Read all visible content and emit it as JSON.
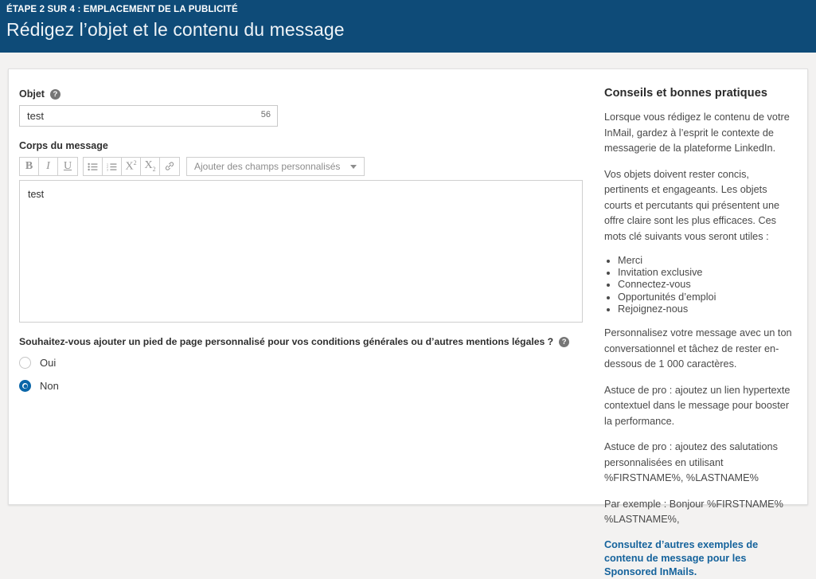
{
  "header": {
    "eyebrow": "ÉTAPE 2 SUR 4 : EMPLACEMENT DE LA PUBLICITÉ",
    "title": "Rédigez l’objet et le contenu du message",
    "bg_color": "#0e4b78"
  },
  "form": {
    "subject": {
      "label": "Objet",
      "help_icon": "help-circle-icon",
      "value": "test",
      "placeholder": "",
      "char_count": "56"
    },
    "body": {
      "label": "Corps du message",
      "value": "test",
      "placeholder": ""
    },
    "toolbar": {
      "bold": "B",
      "italic": "I",
      "underline": "U",
      "bulleted_list_icon": "bulleted-list-icon",
      "numbered_list_icon": "numbered-list-icon",
      "superscript": "X",
      "superscript_exp": "2",
      "subscript": "X",
      "subscript_exp": "2",
      "link_icon": "link-icon",
      "custom_fields_label": "Ajouter des champs personnalisés",
      "caret_icon": "chevron-down-icon"
    },
    "footer_question": {
      "text": "Souhaitez-vous ajouter un pied de page personnalisé pour vos conditions générales ou d’autres mentions légales ?",
      "help_icon": "help-circle-icon",
      "options": [
        {
          "label": "Oui",
          "selected": false
        },
        {
          "label": "Non",
          "selected": true
        }
      ]
    }
  },
  "sidebar": {
    "title": "Conseils et bonnes pratiques",
    "paragraph_1": "Lorsque vous rédigez le contenu de votre InMail, gardez à l’esprit le contexte de messagerie de la plateforme LinkedIn.",
    "paragraph_2": "Vos objets doivent rester concis, pertinents et engageants. Les objets courts et percutants qui présentent une offre claire sont les plus efficaces. Ces mots clé suivants vous seront utiles :",
    "keywords": [
      "Merci",
      "Invitation exclusive",
      "Connectez-vous",
      "Opportunités d’emploi",
      "Rejoignez-nous"
    ],
    "paragraph_3": "Personnalisez votre message avec un ton conversationnel et tâchez de rester en-dessous de 1 000 caractères.",
    "paragraph_4": "Astuce de pro : ajoutez un lien hypertexte contextuel dans le message pour booster la performance.",
    "paragraph_5": "Astuce de pro : ajoutez des salutations personnalisées en utilisant %FIRSTNAME%, %LASTNAME%",
    "paragraph_6": "Par exemple : Bonjour %FIRSTNAME% %LASTNAME%,",
    "link_text": "Consultez d’autres exemples de contenu de message pour les Sponsored InMails.",
    "link_color": "#15639c"
  }
}
